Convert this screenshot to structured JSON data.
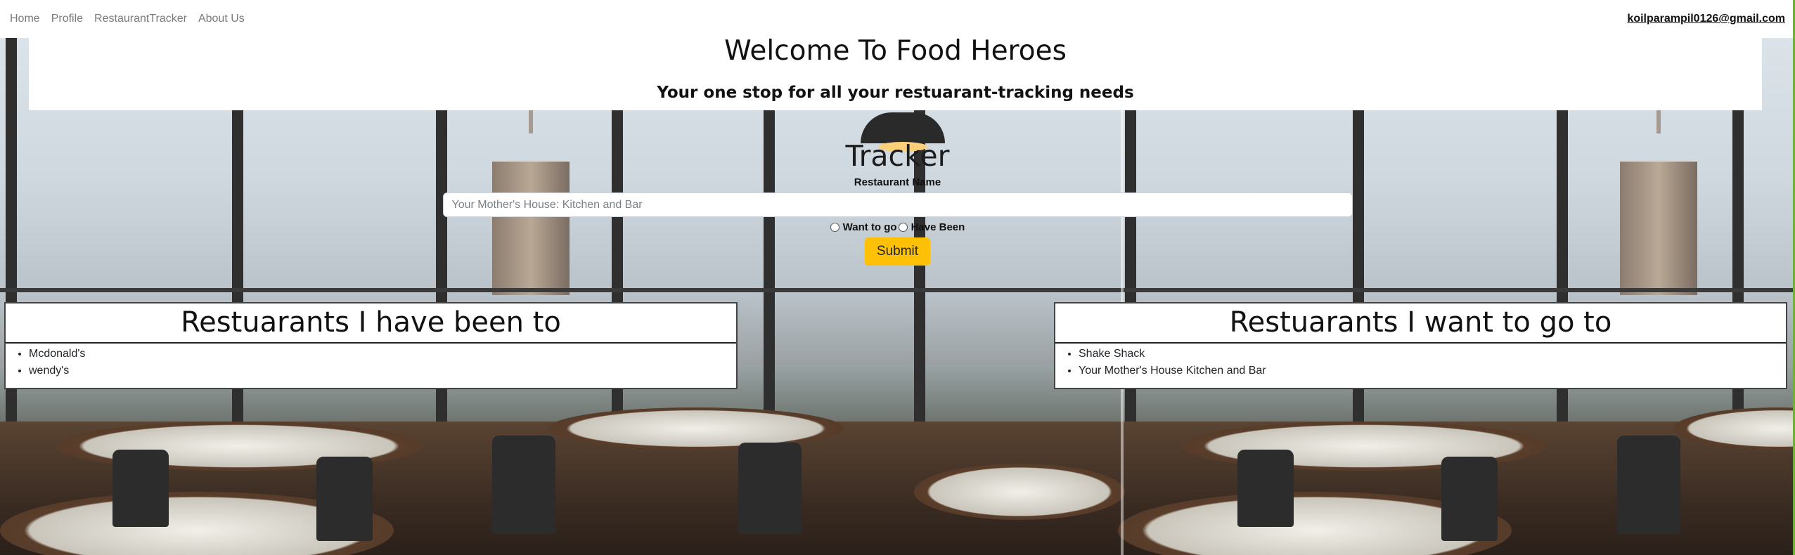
{
  "nav": {
    "links": [
      "Home",
      "Profile",
      "RestaurantTracker",
      "About Us"
    ],
    "user_email": "koilparampil0126@gmail.com"
  },
  "hero": {
    "title": "Welcome To Food Heroes",
    "subtitle": "Your one stop for all your restuarant-tracking needs"
  },
  "tracker": {
    "title": "Tracker",
    "name_label": "Restaurant Name",
    "name_placeholder": "Your Mother's House: Kitchen and Bar",
    "radio_options": [
      "Want to go",
      "Have Been"
    ],
    "submit_label": "Submit"
  },
  "lists": {
    "been": {
      "title": "Restuarants I have been to",
      "items": [
        "Mcdonald's",
        "wendy's"
      ]
    },
    "want": {
      "title": "Restuarants I want to go to",
      "items": [
        "Shake Shack",
        "Your Mother's House Kitchen and Bar"
      ]
    }
  },
  "colors": {
    "submit_button": "#ffc107",
    "nav_link": "#7a7a7a"
  }
}
